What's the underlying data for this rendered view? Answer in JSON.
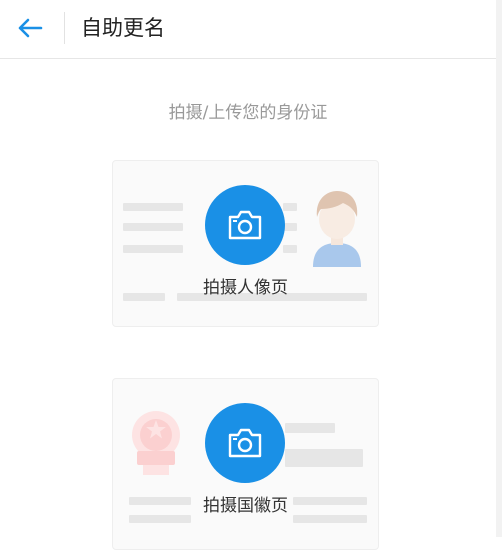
{
  "header": {
    "title": "自助更名",
    "back_icon": "arrow-left-icon",
    "accent_color": "#1a90e6"
  },
  "main": {
    "subtitle": "拍摄/上传您的身份证",
    "cards": [
      {
        "label": "拍摄人像页",
        "icon": "camera-icon",
        "illustration": "person-avatar"
      },
      {
        "label": "拍摄国徽页",
        "icon": "camera-icon",
        "illustration": "national-emblem"
      }
    ]
  }
}
